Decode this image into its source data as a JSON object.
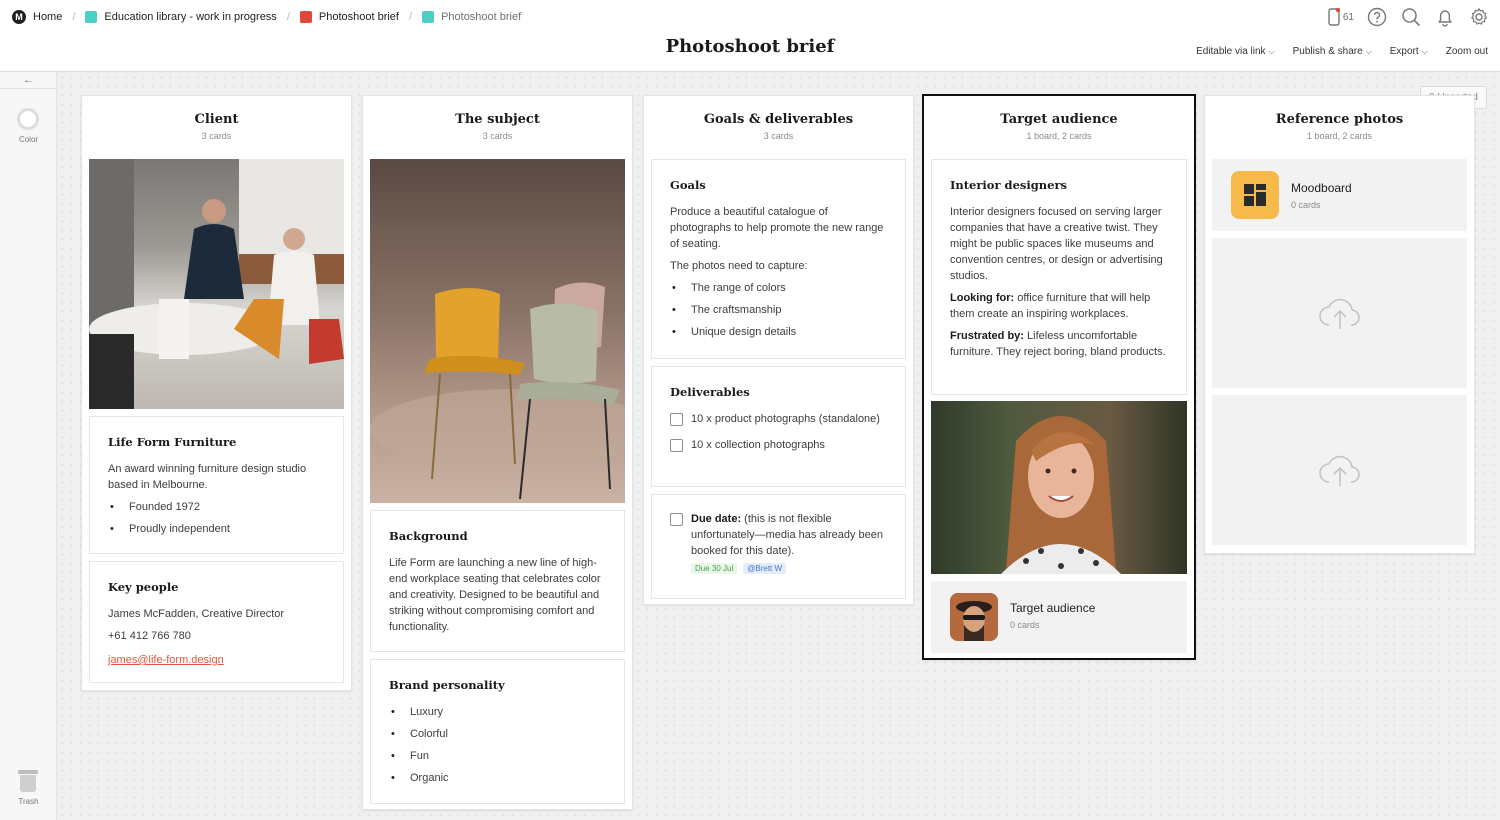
{
  "breadcrumbs": {
    "home": "Home",
    "items": [
      {
        "label": "Education library - work in progress",
        "color": "#4dcfc6"
      },
      {
        "label": "Photoshoot brief",
        "color": "#e0493a"
      },
      {
        "label": "Photoshoot brief",
        "color": "#4dcfc6"
      }
    ]
  },
  "page_title": "Photoshoot brief",
  "top_icons": {
    "device_count": "61",
    "icons": [
      "device-icon",
      "help-icon",
      "search-icon",
      "bell-icon",
      "gear-icon"
    ]
  },
  "share_menu": {
    "editable": "Editable via link",
    "publish": "Publish & share",
    "export": "Export",
    "zoom": "Zoom out"
  },
  "rail": {
    "color_label": "Color",
    "trash_label": "Trash"
  },
  "unsorted": "0 Unsorted",
  "columns": {
    "client": {
      "title": "Client",
      "sub": "3 cards",
      "company_card": {
        "heading": "Life Form Furniture",
        "body": "An award winning furniture design studio based in Melbourne.",
        "bullets": [
          "Founded 1972",
          "Proudly independent"
        ]
      },
      "people_card": {
        "heading": "Key people",
        "name": "James McFadden, Creative Director",
        "phone": "+61 412 766 780",
        "email": "james@life-form.design"
      }
    },
    "subject": {
      "title": "The subject",
      "sub": "3 cards",
      "background_card": {
        "heading": "Background",
        "body": "Life Form are launching a new line of high-end workplace seating that celebrates color and creativity. Designed to be beautiful and striking without compromising comfort and functionality."
      },
      "personality_card": {
        "heading": "Brand personality",
        "bullets": [
          "Luxury",
          "Colorful",
          "Fun",
          "Organic"
        ]
      }
    },
    "goals": {
      "title": "Goals & deliverables",
      "sub": "3 cards",
      "goals_card": {
        "heading": "Goals",
        "body": "Produce a beautiful catalogue of photographs to help promote the new range of seating.",
        "capture": "The photos need to capture:",
        "bullets": [
          "The range of colors",
          "The craftsmanship",
          "Unique design details"
        ]
      },
      "deliverables_card": {
        "heading": "Deliverables",
        "tasks": [
          "10 x product photographs (standalone)",
          "10 x collection photographs"
        ]
      },
      "due_card": {
        "label": "Due date:",
        "text": " (this is not flexible unfortunately—media has already been booked for this date).",
        "due_tag": "Due 30 Jul",
        "user_tag": "@Brett W"
      }
    },
    "audience": {
      "title": "Target audience",
      "sub": "1 board, 2 cards",
      "designers_card": {
        "heading": "Interior designers",
        "body": "Interior designers focused on serving larger companies that have a creative twist. They might be public spaces like museums and convention centres, or design or advertising studios.",
        "looking_label": "Looking for:",
        "looking_text": " office furniture that will help them create an inspiring workplaces.",
        "frustrated_label": "Frustrated by:",
        "frustrated_text": " Lifeless uncomfortable furniture. They reject boring, bland products."
      },
      "board": {
        "name": "Target audience",
        "sub": "0 cards"
      }
    },
    "reference": {
      "title": "Reference photos",
      "sub": "1 board, 2 cards",
      "board": {
        "name": "Moodboard",
        "sub": "0 cards",
        "color": "#f7b94a"
      }
    }
  }
}
